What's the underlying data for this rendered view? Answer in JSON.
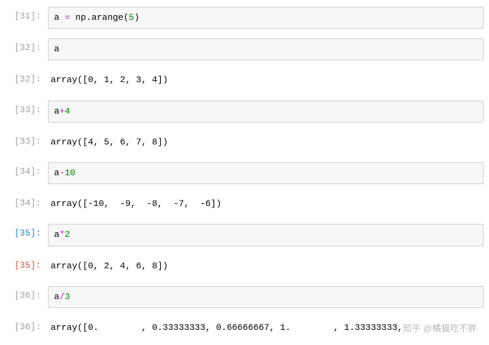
{
  "cells": [
    {
      "type": "in",
      "num": "31",
      "active": false,
      "tokens": [
        {
          "t": "a",
          "c": "tok-name"
        },
        {
          "t": " ",
          "c": ""
        },
        {
          "t": "=",
          "c": "tok-op"
        },
        {
          "t": " ",
          "c": ""
        },
        {
          "t": "np",
          "c": "tok-builtin"
        },
        {
          "t": ".",
          "c": "tok-dot"
        },
        {
          "t": "arange",
          "c": "tok-name"
        },
        {
          "t": "(",
          "c": "tok-paren"
        },
        {
          "t": "5",
          "c": "tok-num"
        },
        {
          "t": ")",
          "c": "tok-paren"
        }
      ]
    },
    {
      "type": "in",
      "num": "32",
      "active": false,
      "tokens": [
        {
          "t": "a",
          "c": "tok-name"
        }
      ]
    },
    {
      "type": "out",
      "num": "32",
      "active": false,
      "text": "array([0, 1, 2, 3, 4])"
    },
    {
      "type": "in",
      "num": "33",
      "active": false,
      "tokens": [
        {
          "t": "a",
          "c": "tok-name"
        },
        {
          "t": "+",
          "c": "tok-op"
        },
        {
          "t": "4",
          "c": "tok-num"
        }
      ]
    },
    {
      "type": "out",
      "num": "33",
      "active": false,
      "text": "array([4, 5, 6, 7, 8])"
    },
    {
      "type": "in",
      "num": "34",
      "active": false,
      "tokens": [
        {
          "t": "a",
          "c": "tok-name"
        },
        {
          "t": "-",
          "c": "tok-op"
        },
        {
          "t": "10",
          "c": "tok-num"
        }
      ]
    },
    {
      "type": "out",
      "num": "34",
      "active": false,
      "text": "array([-10,  -9,  -8,  -7,  -6])"
    },
    {
      "type": "in",
      "num": "35",
      "active": true,
      "tokens": [
        {
          "t": "a",
          "c": "tok-name"
        },
        {
          "t": "*",
          "c": "tok-op"
        },
        {
          "t": "2",
          "c": "tok-num"
        }
      ]
    },
    {
      "type": "out",
      "num": "35",
      "active": true,
      "text": "array([0, 2, 4, 6, 8])"
    },
    {
      "type": "in",
      "num": "36",
      "active": false,
      "tokens": [
        {
          "t": "a",
          "c": "tok-name"
        },
        {
          "t": "/",
          "c": "tok-op"
        },
        {
          "t": "3",
          "c": "tok-num"
        }
      ]
    },
    {
      "type": "out",
      "num": "36",
      "active": false,
      "text": "array([0.        , 0.33333333, 0.66666667, 1.        , 1.33333333,"
    }
  ],
  "watermark": "知乎 @橘猫吃不胖"
}
